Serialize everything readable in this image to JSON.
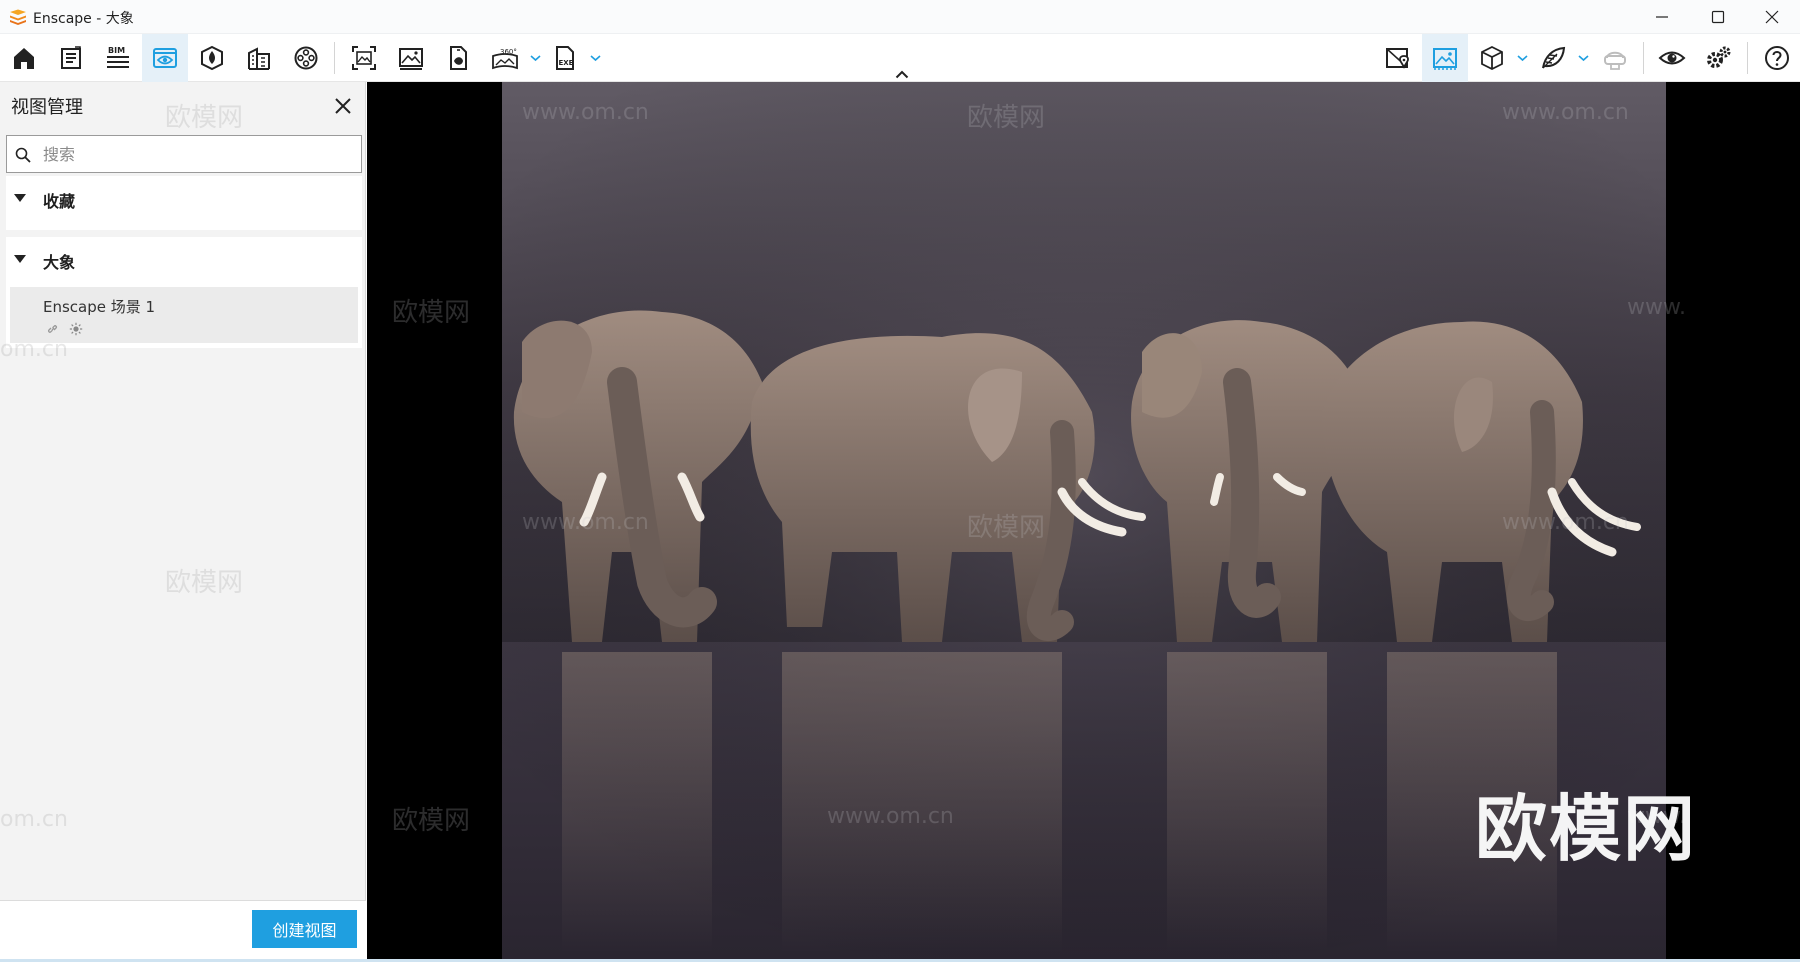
{
  "window": {
    "title": "Enscape - 大象",
    "controls": [
      "minimize",
      "maximize",
      "close"
    ]
  },
  "toolbar": {
    "left_tools": [
      {
        "icon": "home-icon"
      },
      {
        "icon": "notes-icon"
      },
      {
        "icon": "bim-icon",
        "label": "BIM"
      },
      {
        "icon": "view-management-icon",
        "active": true
      },
      {
        "icon": "atmosphere-icon"
      },
      {
        "icon": "material-editor-icon"
      },
      {
        "icon": "video-editor-icon"
      },
      {
        "icon": "batch-render-icon"
      },
      {
        "icon": "screenshot-icon"
      },
      {
        "icon": "panorama-export-icon"
      },
      {
        "icon": "panorama-360-icon",
        "label": "360°"
      },
      {
        "icon": "standalone-exe-icon",
        "label": "EXE"
      }
    ],
    "right_tools": [
      {
        "icon": "map-pin-icon"
      },
      {
        "icon": "image-settings-icon",
        "active": true
      },
      {
        "icon": "cube-icon"
      },
      {
        "icon": "leaf-asset-icon"
      },
      {
        "icon": "vr-headset-icon",
        "disabled": true
      },
      {
        "icon": "visual-settings-eye-icon"
      },
      {
        "icon": "settings-gears-icon"
      },
      {
        "icon": "help-icon"
      }
    ],
    "accent_color": "#1f9fe0"
  },
  "panel": {
    "title": "视图管理",
    "search": {
      "placeholder": "搜索",
      "value": ""
    },
    "groups": [
      {
        "label": "收藏",
        "expanded": true,
        "items": []
      },
      {
        "label": "大象",
        "expanded": true,
        "items": [
          {
            "name": "Enscape 场景 1"
          }
        ]
      }
    ],
    "create_button": "创建视图"
  },
  "viewport": {
    "subject": "four elephants on reflective floor",
    "watermarks": {
      "site": "www.om.cn",
      "brand": "欧模网",
      "partial": "om.cn",
      "partial_right": "www."
    }
  }
}
